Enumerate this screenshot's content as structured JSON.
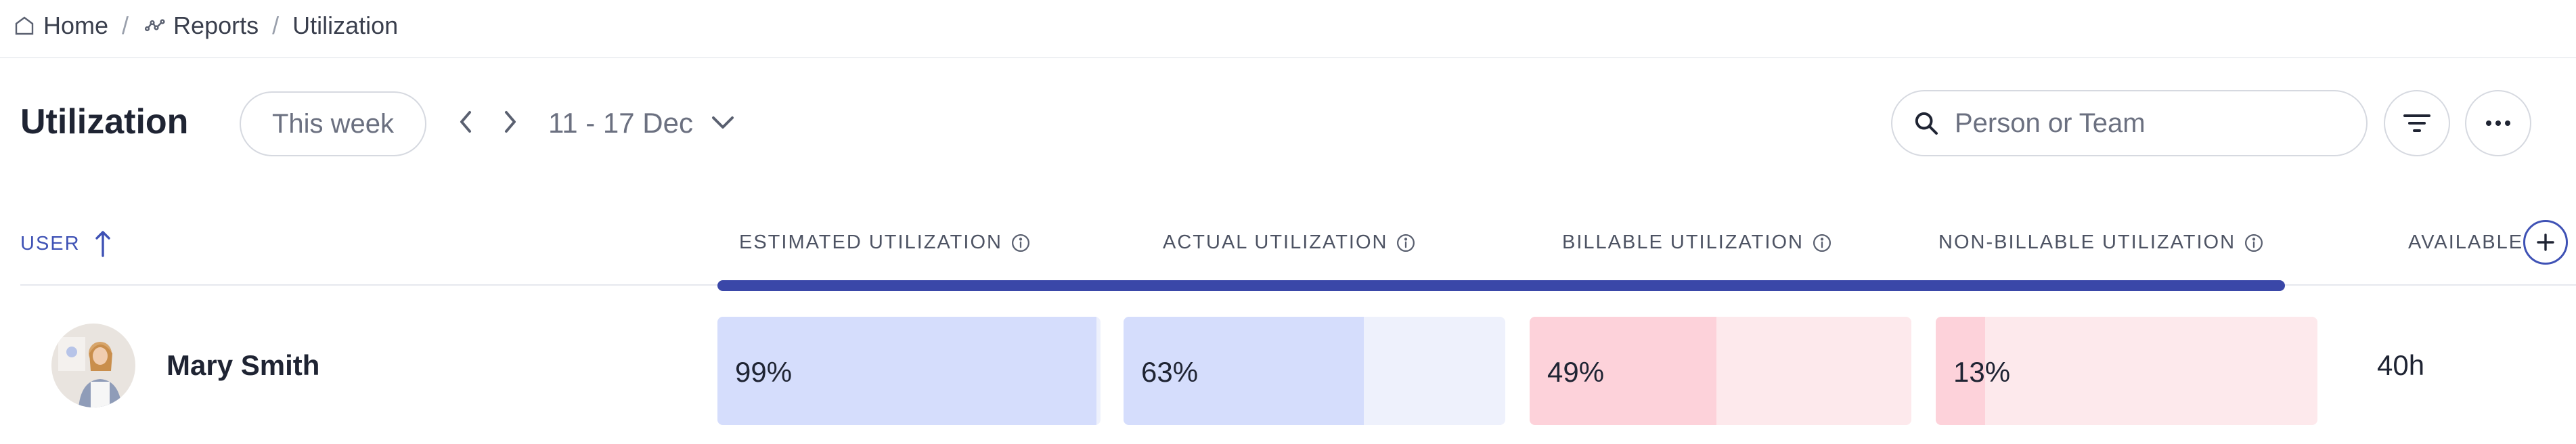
{
  "breadcrumb": {
    "home": "Home",
    "reports": "Reports",
    "current": "Utilization",
    "separator": "/"
  },
  "header": {
    "title": "Utilization",
    "period_button": "This week",
    "date_range": "11 - 17 Dec",
    "search_placeholder": "Person or Team"
  },
  "table": {
    "columns": {
      "user": "USER",
      "estimated": "ESTIMATED UTILIZATION",
      "actual": "ACTUAL UTILIZATION",
      "billable": "BILLABLE UTILIZATION",
      "non_billable": "NON-BILLABLE UTILIZATION",
      "available": "AVAILABLE"
    },
    "rows": [
      {
        "name": "Mary Smith",
        "estimated": {
          "label": "99%",
          "value": 0.99
        },
        "actual": {
          "label": "63%",
          "value": 0.63
        },
        "billable": {
          "label": "49%",
          "value": 0.49
        },
        "non_billable": {
          "label": "13%",
          "value": 0.13
        },
        "available": "40h"
      }
    ]
  },
  "colors": {
    "accent": "#3a47a8",
    "blue_fill": "#d5ddfc",
    "blue_track": "#eef1fc",
    "pink_fill": "#fdd2da",
    "pink_track": "#fde9ec"
  }
}
